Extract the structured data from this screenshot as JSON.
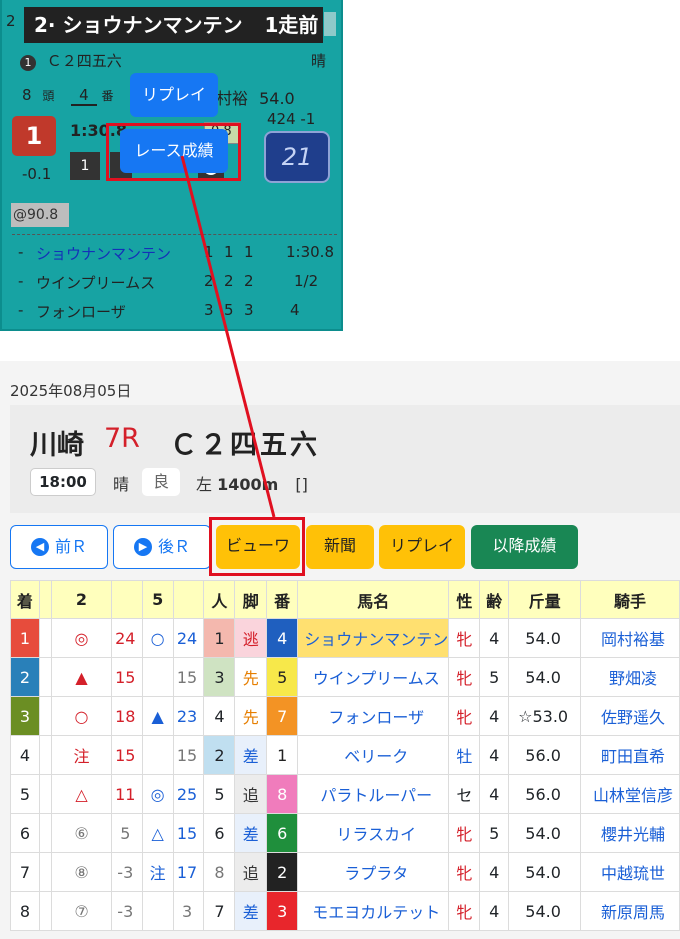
{
  "card": {
    "title": "2· ショウナンマンテン",
    "title_right": "1走前",
    "hidden_left": "2",
    "race_num_circle": "1",
    "race_class": "Ｃ２四五六",
    "weather": "晴",
    "field_size": "8",
    "field_unit": "頭",
    "horse_num": "4",
    "horse_num_unit": "番",
    "jockey_partial": "村裕",
    "weight_carried": "54.0",
    "finish_pos": "1",
    "time_partial": "1:30.8",
    "chip_value": "0.8",
    "body_weight": "424 -1",
    "margin": "-0.1",
    "corner_first": "1",
    "corner_circle": "2",
    "speed_index": "21",
    "odds": "@90.8",
    "replay_label": "リプレイ",
    "results_label": "レース成績",
    "prev_rows": [
      {
        "dash": "-",
        "name": "ショウナンマンテン",
        "c1": "1",
        "c2": "1",
        "c3": "1",
        "res": "1:30.8",
        "highlight": true
      },
      {
        "dash": "-",
        "name": "ウインプリームス",
        "c1": "2",
        "c2": "2",
        "c3": "2",
        "res": "1/2",
        "highlight": false
      },
      {
        "dash": "-",
        "name": "フォンローザ",
        "c1": "3",
        "c2": "5",
        "c3": "3",
        "res": "4",
        "highlight": false
      }
    ]
  },
  "race": {
    "date": "2025年08月05日",
    "venue": "川崎",
    "race_no": "7R",
    "class": "Ｃ２四五六",
    "start_time": "18:00",
    "weather": "晴",
    "track_condition": "良",
    "direction": "左",
    "distance": "1400m",
    "extra": "[]"
  },
  "buttons": {
    "prev": "前Ｒ",
    "next": "後Ｒ",
    "viewer": "ビューワ",
    "newspaper": "新聞",
    "replay": "リプレイ",
    "after_results": "以降成績"
  },
  "table": {
    "headers": [
      "着",
      "",
      "2",
      "",
      "5",
      "",
      "人",
      "脚",
      "番",
      "馬名",
      "性",
      "齢",
      "斤量",
      "騎手"
    ],
    "rows": [
      {
        "pos": "1",
        "m2": "◎",
        "v2": "24",
        "m5": "○",
        "v5": "24",
        "pop": "1",
        "style": "逃",
        "num": "4",
        "name": "ショウナンマンテン",
        "sex": "牝",
        "age": "4",
        "weight": "54.0",
        "jockey": "岡村裕基"
      },
      {
        "pos": "2",
        "m2": "▲",
        "v2": "15",
        "m5": "",
        "v5": "15",
        "pop": "3",
        "style": "先",
        "num": "5",
        "name": "ウインプリームス",
        "sex": "牝",
        "age": "5",
        "weight": "54.0",
        "jockey": "野畑凌"
      },
      {
        "pos": "3",
        "m2": "○",
        "v2": "18",
        "m5": "▲",
        "v5": "23",
        "pop": "4",
        "style": "先",
        "num": "7",
        "name": "フォンローザ",
        "sex": "牝",
        "age": "4",
        "weight": "☆53.0",
        "jockey": "佐野遥久"
      },
      {
        "pos": "4",
        "m2": "注",
        "v2": "15",
        "m5": "",
        "v5": "15",
        "pop": "2",
        "style": "差",
        "num": "1",
        "name": "ベリーク",
        "sex": "牡",
        "age": "4",
        "weight": "56.0",
        "jockey": "町田直希"
      },
      {
        "pos": "5",
        "m2": "△",
        "v2": "11",
        "m5": "◎",
        "v5": "25",
        "pop": "5",
        "style": "追",
        "num": "8",
        "name": "パラトルーパー",
        "sex": "セ",
        "age": "4",
        "weight": "56.0",
        "jockey": "山林堂信彦"
      },
      {
        "pos": "6",
        "m2": "⑥",
        "v2": "5",
        "m5": "△",
        "v5": "15",
        "pop": "6",
        "style": "差",
        "num": "6",
        "name": "リラスカイ",
        "sex": "牝",
        "age": "5",
        "weight": "54.0",
        "jockey": "櫻井光輔"
      },
      {
        "pos": "7",
        "m2": "⑧",
        "v2": "-3",
        "m5": "注",
        "v5": "17",
        "pop": "8",
        "style": "追",
        "num": "2",
        "name": "ラプラタ",
        "sex": "牝",
        "age": "4",
        "weight": "54.0",
        "jockey": "中越琉世"
      },
      {
        "pos": "8",
        "m2": "⑦",
        "v2": "-3",
        "m5": "",
        "v5": "3",
        "pop": "7",
        "style": "差",
        "num": "3",
        "name": "モエヨカルテット",
        "sex": "牝",
        "age": "4",
        "weight": "54.0",
        "jockey": "新原周馬"
      }
    ]
  }
}
